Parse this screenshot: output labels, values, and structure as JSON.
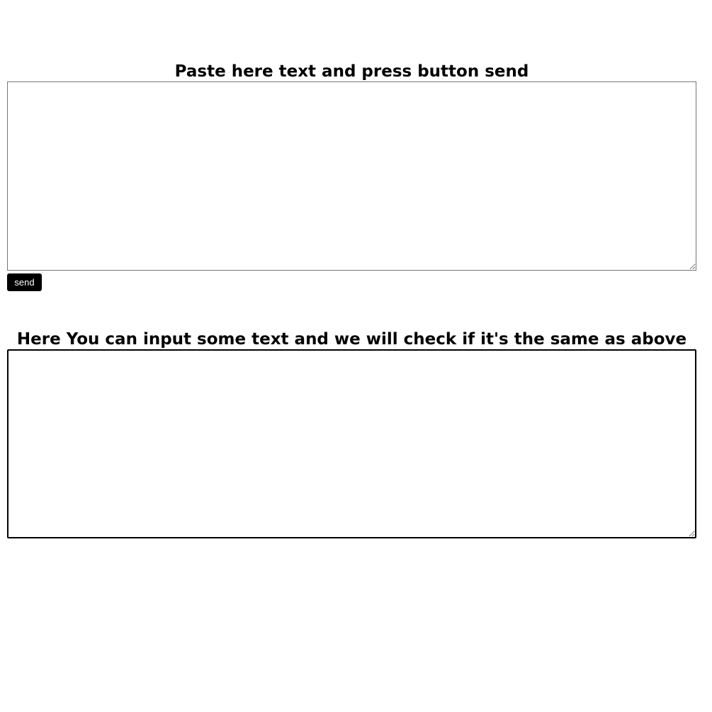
{
  "top_section": {
    "heading": "Paste here text and press button send",
    "textarea_value": "",
    "send_label": "send"
  },
  "bottom_section": {
    "heading": "Here You can input some text and we will check if it's the same as above",
    "textarea_value": ""
  },
  "colors": {
    "button_background": "#000000",
    "button_text": "#ffffff",
    "page_background": "#ffffff"
  }
}
